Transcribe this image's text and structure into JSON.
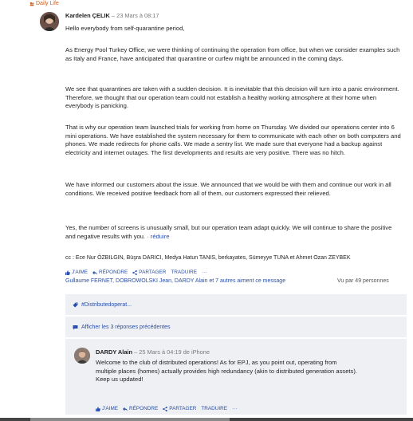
{
  "group": {
    "label": "Daily Life",
    "icon": "group-icon"
  },
  "post": {
    "author": "Kardelen ÇELIK",
    "date": "– 23 Mars à 08:17",
    "greeting": "Hello everybody from self-quarantine period,",
    "paragraphs": [
      "As Energy Pool Turkey Office, we were thinking of continuing the operation from office, but when we consider examples such as Italy and France, have anticipated that quarantine or curfew might be announced in the coming days.",
      "We see that quarantines are taken with a sudden decision. It is inevitable that this decision will turn into a panic environment. Therefore, we thought that our operation team could not establish a healthy working atmosphere at their home when everybody is panicking.",
      "That is why our operation team launched trials for working from home on Thursday. We divided our operations center into 6 mini operations. We have established the system necessary for them to communicate with each other on both computers and phones. We made redirects for phone calls. We made a sentry list. We made sure that everyone had a backup against electricity and internet outages. The first developments and results are very positive. There was no hitch.",
      "We have informed our customers about the issue. We announced that we would be with them and continue our work in all conditions. We received positive feedback from all of them, our customers expressed their relieved.",
      "Yes, the number of screens is unusually small, but our operation team adapt quickly. We will continue to share the positive and negative results with you."
    ],
    "reduce_link": "· réduire",
    "cc": "cc : Ece Nur ÖZBILGIN, Büşra DARICI, Medya Hatun TANIS, berkayates, Sümeyye TUNA et Ahmet Ozan ZEYBEK"
  },
  "actions": {
    "like": "J'AIME",
    "reply": "RÉPONDRE",
    "share": "PARTAGER",
    "translate": "TRADUIRE",
    "more": "···"
  },
  "likes_line": "Gullaume FERNET, DOBROWOLSKI Jean, DARDY Alain et 7 autres aiment ce message",
  "seen_by": "Vu par 49 personnes",
  "topic": "#Distributedoperat...",
  "previous_replies": "Afficher les 3 réponses précédentes",
  "reply": {
    "author": "DARDY Alain",
    "date": "– 25 Mars à 04:19 de iPhone",
    "text": "Welcome to the club of distributed operations! As for EPJ, as you point out, operating from multiple places (homes) actually provides high redundancy (akin to distributed generation assets).",
    "closing": "Keep us updated!",
    "actions": {
      "like": "J'AIME",
      "reply": "RÉPONDRE",
      "share": "PARTAGER",
      "translate": "TRADUIRE",
      "more": "···"
    }
  },
  "colors": {
    "link": "#2a4fa8",
    "group_tag": "#c8621e",
    "panel_bg": "#eef0f4"
  }
}
